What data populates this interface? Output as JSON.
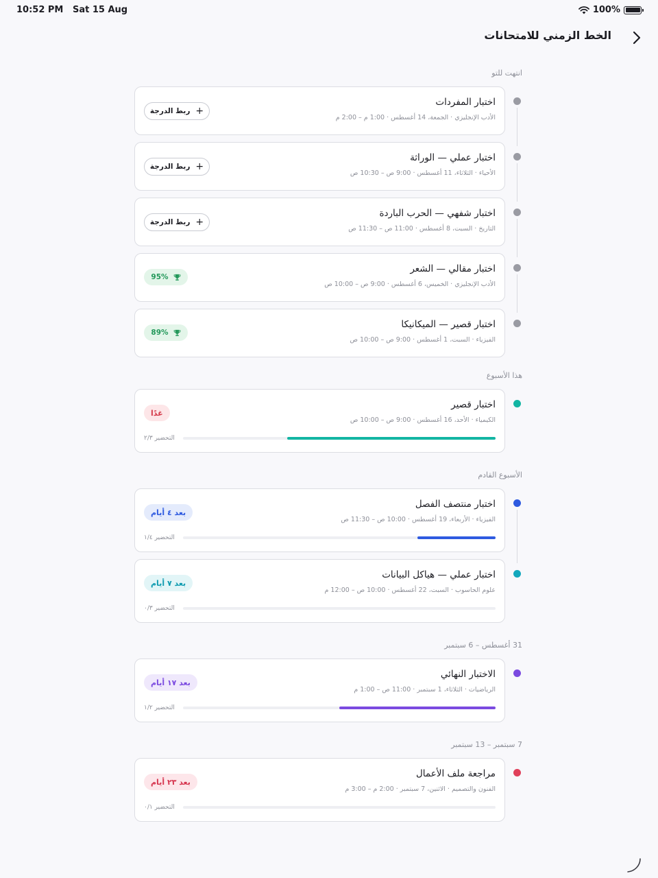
{
  "status_bar": {
    "time": "10:52 PM",
    "date": "Sat 15 Aug",
    "battery": "100%"
  },
  "nav": {
    "title": "الخط الزمني للامتحانات",
    "back_icon": "chevron-icon"
  },
  "sections": [
    {
      "label": "انتهت للتو",
      "items": [
        {
          "title": "اختبار المفردات",
          "meta": "الأدب الإنجليزي · الجمعة، 14 أغسطس · 1:00 م – 2:00 م",
          "dot_color": "#9a9ba3",
          "action": "ربط الدرجة"
        },
        {
          "title": "اختبار عملي — الوراثة",
          "meta": "الأحياء · الثلاثاء، 11 أغسطس · 9:00 ص – 10:30 ص",
          "dot_color": "#9a9ba3",
          "action": "ربط الدرجة"
        },
        {
          "title": "اختبار شفهي — الحرب الباردة",
          "meta": "التاريخ · السبت، 8 أغسطس · 11:00 ص – 11:30 ص",
          "dot_color": "#9a9ba3",
          "action": "ربط الدرجة"
        },
        {
          "title": "اختبار مقالي — الشعر",
          "meta": "الأدب الإنجليزي · الخميس، 6 أغسطس · 9:00 ص – 10:00 ص",
          "dot_color": "#9a9ba3",
          "score": "95%"
        },
        {
          "title": "اختبار قصير — الميكانيكا",
          "meta": "الفيزياء · السبت، 1 أغسطس · 9:00 ص – 10:00 ص",
          "dot_color": "#9a9ba3",
          "score": "89%"
        }
      ]
    },
    {
      "label": "هذا الأسبوع",
      "items": [
        {
          "title": "اختبار قصير",
          "meta": "الكيمياء · الأحد، 16 أغسطس · 9:00 ص – 10:00 ص",
          "dot_color": "#13b5a3",
          "pill": "غدًا",
          "pill_bg": "#fde6e8",
          "pill_color": "#d43a4a",
          "prep": "التحضير ٢/٣",
          "progress": 0.667,
          "bar_color": "#13b5a3"
        }
      ]
    },
    {
      "label": "الأسبوع القادم",
      "items": [
        {
          "title": "اختبار منتصف الفصل",
          "meta": "الفيزياء · الأربعاء، 19 أغسطس · 10:00 ص – 11:30 ص",
          "dot_color": "#2e5ae0",
          "pill": "بعد ٤ أيام",
          "pill_bg": "#e4ebfc",
          "pill_color": "#2e5ae0",
          "prep": "التحضير ١/٤",
          "progress": 0.25,
          "bar_color": "#2e5ae0"
        },
        {
          "title": "اختبار عملي — هياكل البيانات",
          "meta": "علوم الحاسوب · السبت، 22 أغسطس · 10:00 ص – 12:00 م",
          "dot_color": "#13a8bd",
          "pill": "بعد ٧ أيام",
          "pill_bg": "#e2f5f7",
          "pill_color": "#0f9bb0",
          "prep": "التحضير ٠/٣",
          "progress": 0,
          "bar_color": "#13a8bd"
        }
      ]
    },
    {
      "label": "31 أغسطس – 6 سبتمبر",
      "items": [
        {
          "title": "الاختبار النهائي",
          "meta": "الرياضيات · الثلاثاء، 1 سبتمبر · 11:00 ص – 1:00 م",
          "dot_color": "#7b4ae0",
          "pill": "بعد ١٧ أيام",
          "pill_bg": "#efe8fc",
          "pill_color": "#7b4ae0",
          "prep": "التحضير ١/٢",
          "progress": 0.5,
          "bar_color": "#7b4ae0"
        }
      ]
    },
    {
      "label": "7 سبتمبر – 13 سبتمبر",
      "items": [
        {
          "title": "مراجعة ملف الأعمال",
          "meta": "الفنون والتصميم · الاثنين، 7 سبتمبر · 2:00 م – 3:00 م",
          "dot_color": "#e0405a",
          "pill": "بعد ٢٣ أيام",
          "pill_bg": "#fde6ea",
          "pill_color": "#d6354f",
          "prep": "التحضير ٠/١",
          "progress": 0,
          "bar_color": "#e0405a"
        }
      ]
    }
  ]
}
